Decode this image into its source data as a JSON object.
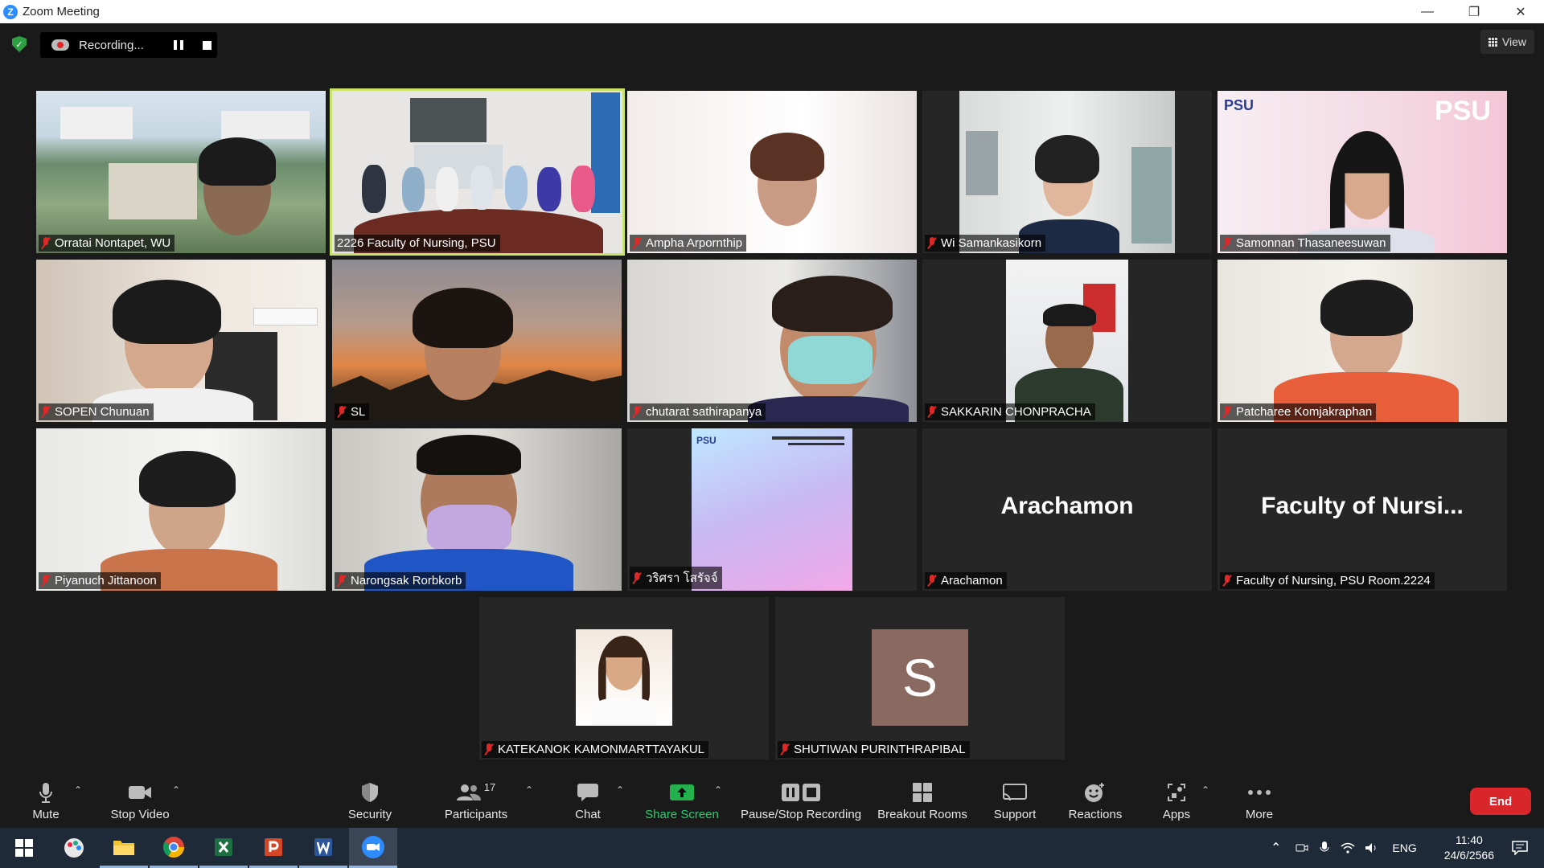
{
  "window": {
    "title": "Zoom Meeting"
  },
  "meeting_bar": {
    "recording_label": "Recording...",
    "view_label": "View"
  },
  "participants": [
    {
      "name": "Orratai Nontapet, WU",
      "muted": true
    },
    {
      "name": "2226 Faculty of Nursing, PSU",
      "muted": false,
      "active_speaker": true
    },
    {
      "name": "Ampha  Arpornthip",
      "muted": true
    },
    {
      "name": "Wi Samankasikorn",
      "muted": true
    },
    {
      "name": "Samonnan Thasaneesuwan",
      "muted": true
    },
    {
      "name": "SOPEN Chunuan",
      "muted": true
    },
    {
      "name": "SL",
      "muted": true
    },
    {
      "name": "chutarat sathirapanya",
      "muted": true
    },
    {
      "name": "SAKKARIN CHONPRACHA",
      "muted": true
    },
    {
      "name": "Patcharee Komjakraphan",
      "muted": true
    },
    {
      "name": "Piyanuch Jittanoon",
      "muted": true
    },
    {
      "name": "Narongsak Rorbkorb",
      "muted": true
    },
    {
      "name": "วริศรา โสรัจจ์",
      "muted": true
    },
    {
      "name": "Arachamon",
      "muted": true,
      "display_text": "Arachamon"
    },
    {
      "name": "Faculty of Nursing, PSU Room.2224",
      "muted": true,
      "display_text": "Faculty of Nursi..."
    },
    {
      "name": "KATEKANOK KAMONMARTTAYAKUL",
      "muted": true
    },
    {
      "name": "SHUTIWAN PURINTHRAPIBAL",
      "muted": true,
      "avatar_letter": "S"
    }
  ],
  "toolbar": {
    "mute": "Mute",
    "stop_video": "Stop Video",
    "security": "Security",
    "participants": "Participants",
    "participants_count": "17",
    "chat": "Chat",
    "share_screen": "Share Screen",
    "pause_stop_recording": "Pause/Stop Recording",
    "breakout_rooms": "Breakout Rooms",
    "support": "Support",
    "reactions": "Reactions",
    "apps": "Apps",
    "more": "More",
    "end": "End"
  },
  "taskbar": {
    "language": "ENG",
    "time": "11:40",
    "date": "24/6/2566"
  },
  "colors": {
    "accent_green": "#2ea043",
    "end_red": "#d9262b",
    "active_outline": "#c8e46a",
    "zoom_blue": "#2d8cff"
  }
}
